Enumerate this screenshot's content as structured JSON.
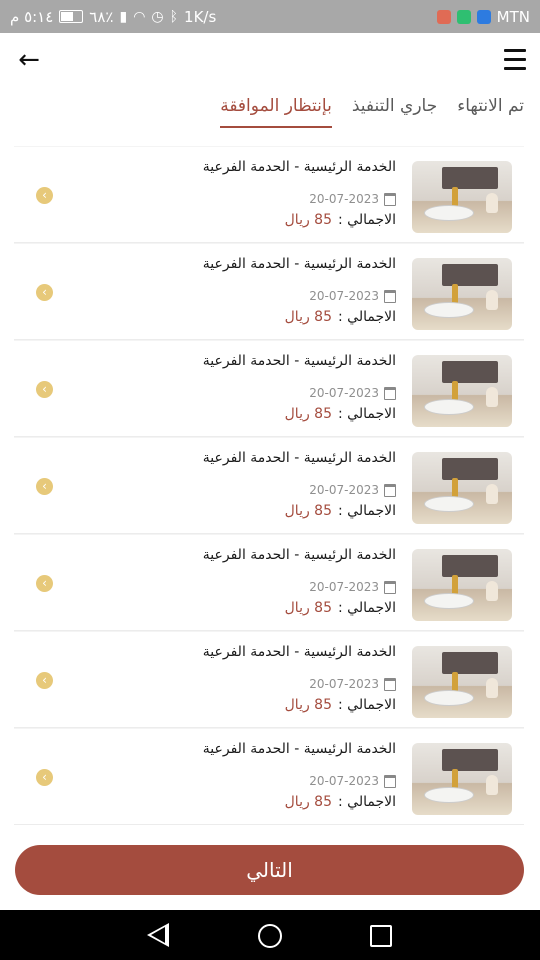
{
  "status_bar": {
    "time": "٥:١٤ م",
    "battery": "٦٨٪",
    "speed": "1K/s",
    "carrier": "MTN"
  },
  "header": {
    "back_icon": "arrow-left-icon",
    "menu_icon": "hamburger-menu-icon"
  },
  "tabs": [
    {
      "label": "بإنتظار الموافقة",
      "active": true
    },
    {
      "label": "جاري التنفيذ",
      "active": false
    },
    {
      "label": "تم الانتهاء",
      "active": false
    }
  ],
  "orders": [
    {
      "title": "الخدمة الرئيسية - الحدمة الفرعية",
      "date": "20-07-2023",
      "total_label": "الاجمالي :",
      "amount": "85 ريال"
    },
    {
      "title": "الخدمة الرئيسية - الحدمة الفرعية",
      "date": "20-07-2023",
      "total_label": "الاجمالي :",
      "amount": "85 ريال"
    },
    {
      "title": "الخدمة الرئيسية - الحدمة الفرعية",
      "date": "20-07-2023",
      "total_label": "الاجمالي :",
      "amount": "85 ريال"
    },
    {
      "title": "الخدمة الرئيسية - الحدمة الفرعية",
      "date": "20-07-2023",
      "total_label": "الاجمالي :",
      "amount": "85 ريال"
    },
    {
      "title": "الخدمة الرئيسية - الحدمة الفرعية",
      "date": "20-07-2023",
      "total_label": "الاجمالي :",
      "amount": "85 ريال"
    },
    {
      "title": "الخدمة الرئيسية - الحدمة الفرعية",
      "date": "20-07-2023",
      "total_label": "الاجمالي :",
      "amount": "85 ريال"
    },
    {
      "title": "الخدمة الرئيسية - الحدمة الفرعية",
      "date": "20-07-2023",
      "total_label": "الاجمالي :",
      "amount": "85 ريال"
    }
  ],
  "next_button": {
    "label": "التالي"
  },
  "colors": {
    "accent": "#a44c3e",
    "arrow_badge": "#e7c97a"
  }
}
